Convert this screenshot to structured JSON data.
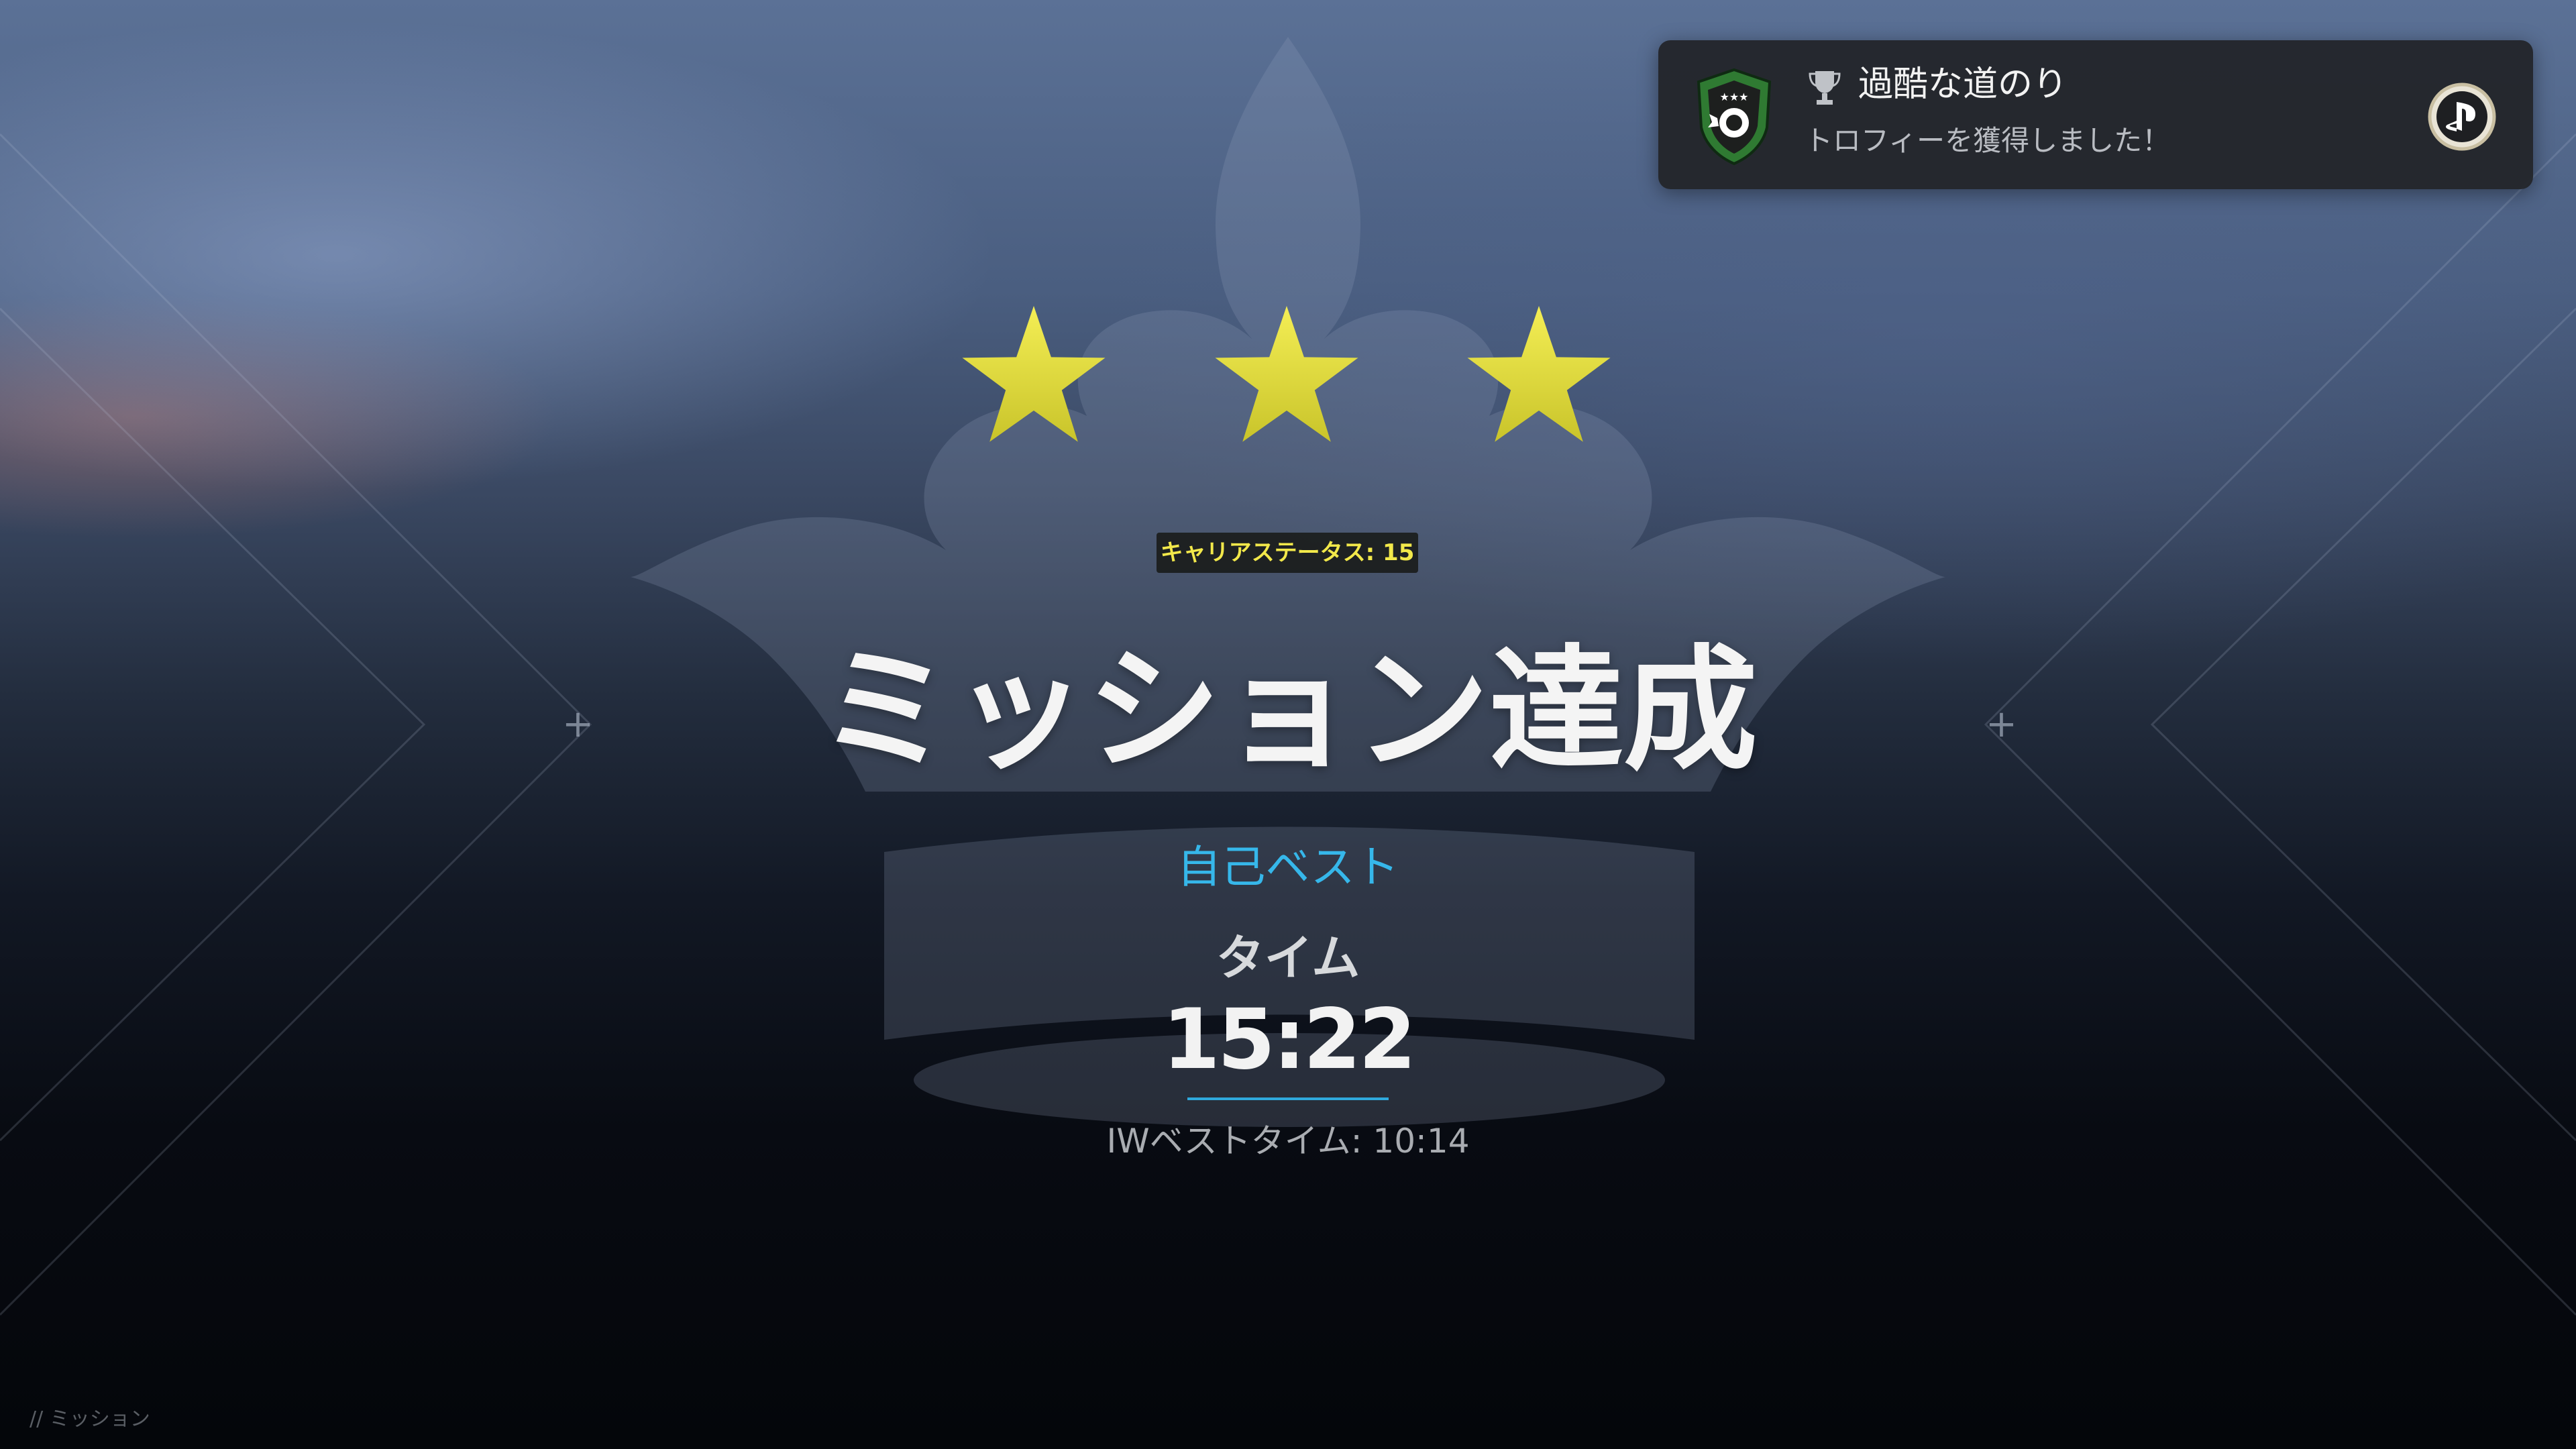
{
  "trophy_notification": {
    "title": "過酷な道のり",
    "subtitle": "トロフィーを獲得しました！",
    "badge_icon": "trophy-badge-icon",
    "trophy_icon": "trophy-icon",
    "platform_icon": "playstation-icon"
  },
  "result": {
    "stars_earned": 3,
    "stars_total": 3,
    "star_color": "#e8e233",
    "career_status": "キャリアステータス: 15",
    "headline": "ミッション達成",
    "personal_best_label": "自己ベスト",
    "time_label": "タイム",
    "time_value": "15:22",
    "iw_best_time": "IWベストタイム: 10:14",
    "accent_color": "#36b7ea"
  },
  "footer": {
    "breadcrumb": "// ミッション"
  }
}
